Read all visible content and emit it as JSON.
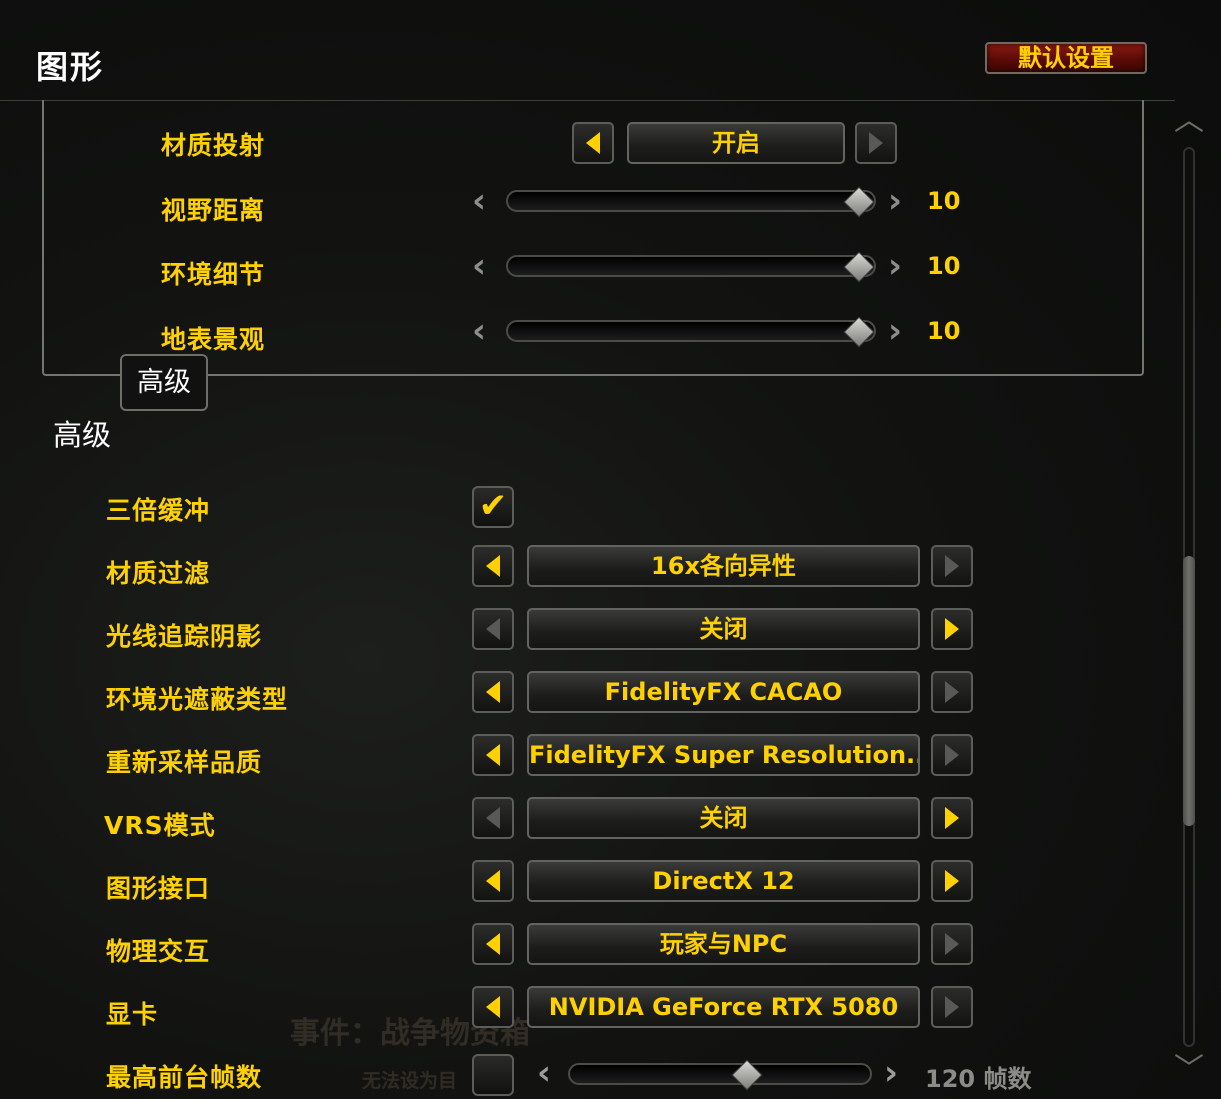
{
  "header": {
    "title": "图形",
    "default_button": "默认设置"
  },
  "top_section": {
    "rows": [
      {
        "label": "材质投射",
        "value": "开启"
      },
      {
        "label": "视野距离",
        "value": "10",
        "level": 1.0
      },
      {
        "label": "环境细节",
        "value": "10",
        "level": 1.0
      },
      {
        "label": "地表景观",
        "value": "10",
        "level": 1.0
      }
    ]
  },
  "tab": {
    "label": "高级"
  },
  "advanced": {
    "title": "高级",
    "rows": [
      {
        "label": "三倍缓冲",
        "checked": true
      },
      {
        "label": "材质过滤",
        "value": "16x各向异性"
      },
      {
        "label": "光线追踪阴影",
        "value": "关闭"
      },
      {
        "label": "环境光遮蔽类型",
        "value": "FidelityFX CACAO"
      },
      {
        "label": "重新采样品质",
        "value": "FidelityFX Super Resolution..."
      },
      {
        "label": "VRS模式",
        "value": "关闭"
      },
      {
        "label": "图形接口",
        "value": "DirectX 12"
      },
      {
        "label": "物理交互",
        "value": "玩家与NPC"
      },
      {
        "label": "显卡",
        "value": "NVIDIA GeForce RTX 5080"
      },
      {
        "label": "最高前台帧数",
        "value": "120 帧数",
        "checked": false
      }
    ]
  },
  "background": {
    "event_text": "事件：战争物资箱",
    "sub_text": "无法设为目"
  },
  "icons": {
    "left": "arrow-left-icon",
    "right": "arrow-right-icon",
    "check": "checkmark-icon",
    "scroll_up": "chevron-up-icon",
    "scroll_down": "chevron-down-icon"
  },
  "colors": {
    "accent": "#ffd100",
    "button_red": "#7a140c",
    "border": "#63645f"
  }
}
